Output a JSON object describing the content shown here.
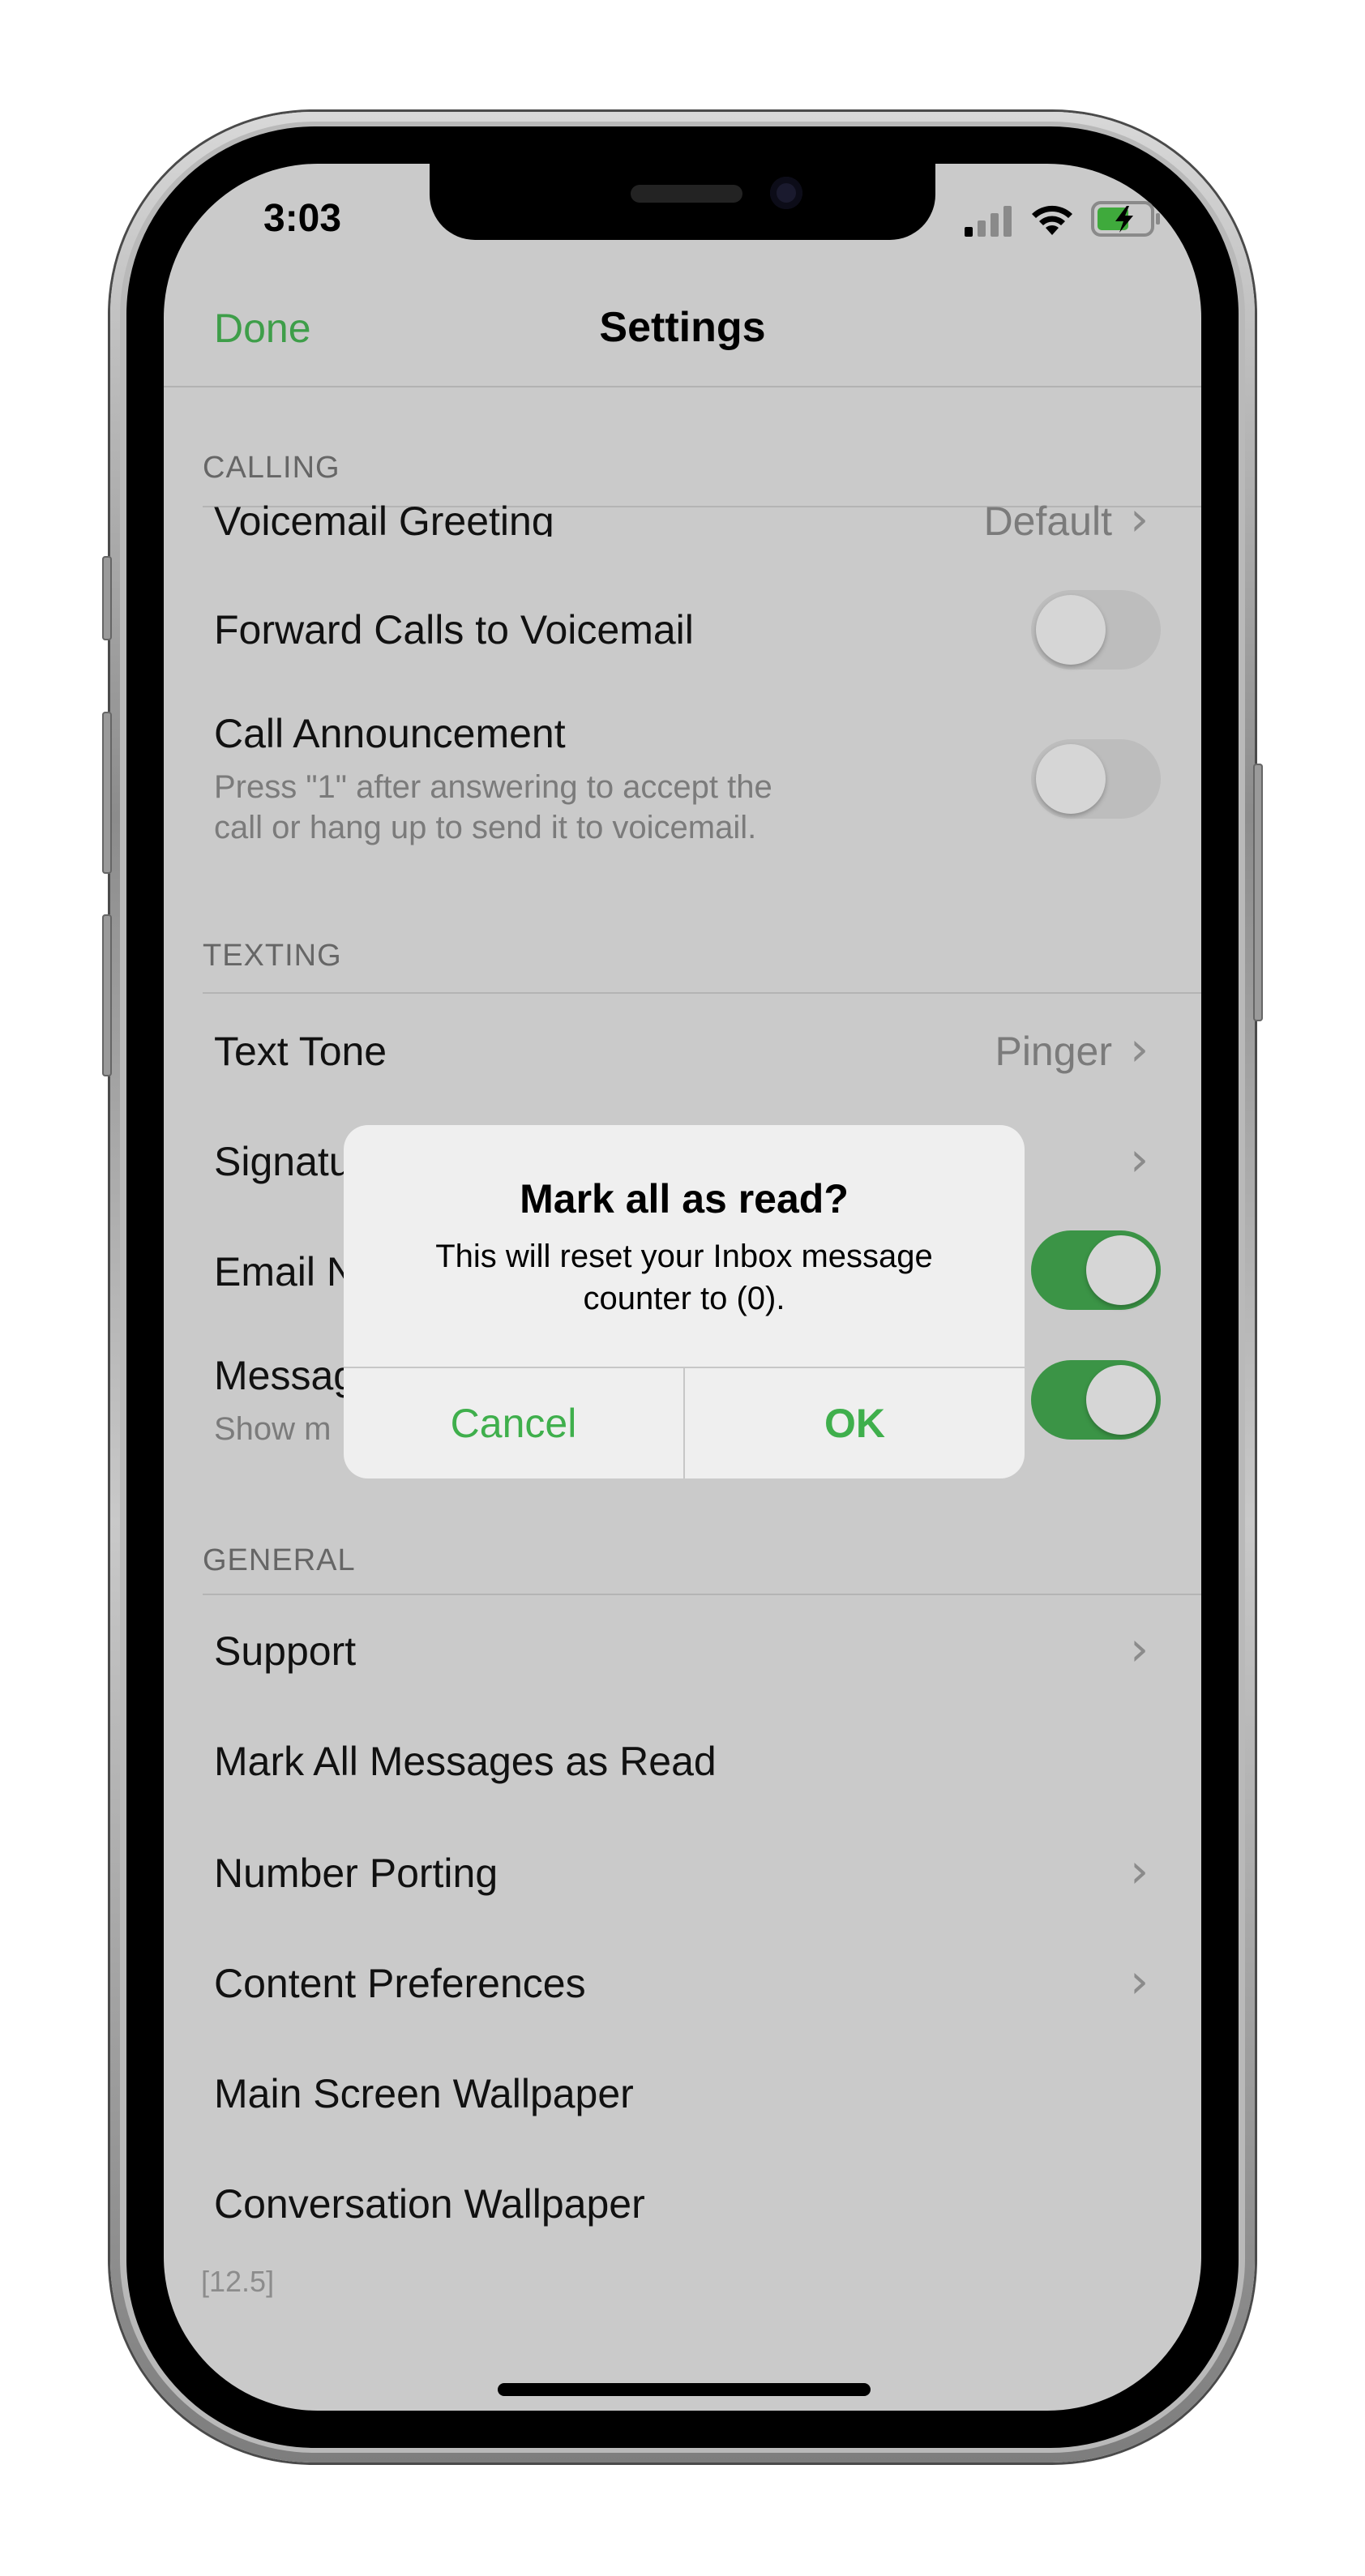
{
  "status_bar": {
    "time": "3:03"
  },
  "nav": {
    "done_label": "Done",
    "title": "Settings"
  },
  "sections": {
    "calling": {
      "header": "CALLING",
      "voicemail_greeting": {
        "label": "Voicemail Greeting",
        "value": "Default"
      },
      "forward_calls": {
        "label": "Forward Calls to Voicemail",
        "enabled": false
      },
      "call_announcement": {
        "label": "Call Announcement",
        "subtitle_line1": "Press \"1\" after answering to accept the",
        "subtitle_line2": "call or hang up to send it to voicemail.",
        "enabled": false
      }
    },
    "texting": {
      "header": "TEXTING",
      "text_tone": {
        "label": "Text Tone",
        "value": "Pinger"
      },
      "signature": {
        "label": "Signatu"
      },
      "email_notifications": {
        "label": "Email N",
        "enabled": true
      },
      "message_preview": {
        "label": "Messag",
        "subtitle": "Show m",
        "enabled": true
      }
    },
    "general": {
      "header": "GENERAL",
      "items": [
        {
          "label": "Support",
          "chevron": true
        },
        {
          "label": "Mark All Messages as Read",
          "chevron": false
        },
        {
          "label": "Number Porting",
          "chevron": true
        },
        {
          "label": "Content Preferences",
          "chevron": true
        },
        {
          "label": "Main Screen Wallpaper",
          "chevron": false
        },
        {
          "label": "Conversation Wallpaper",
          "chevron": false
        }
      ]
    }
  },
  "version": "[12.5]",
  "alert": {
    "title": "Mark all as read?",
    "message_line1": "This will reset your Inbox message",
    "message_line2": "counter to (0).",
    "cancel_label": "Cancel",
    "ok_label": "OK"
  },
  "chevron_glyph": "›",
  "colors": {
    "accent_green": "#3e9e49",
    "toggle_on": "#3b9446",
    "dimmed_background": "#cacaca"
  }
}
